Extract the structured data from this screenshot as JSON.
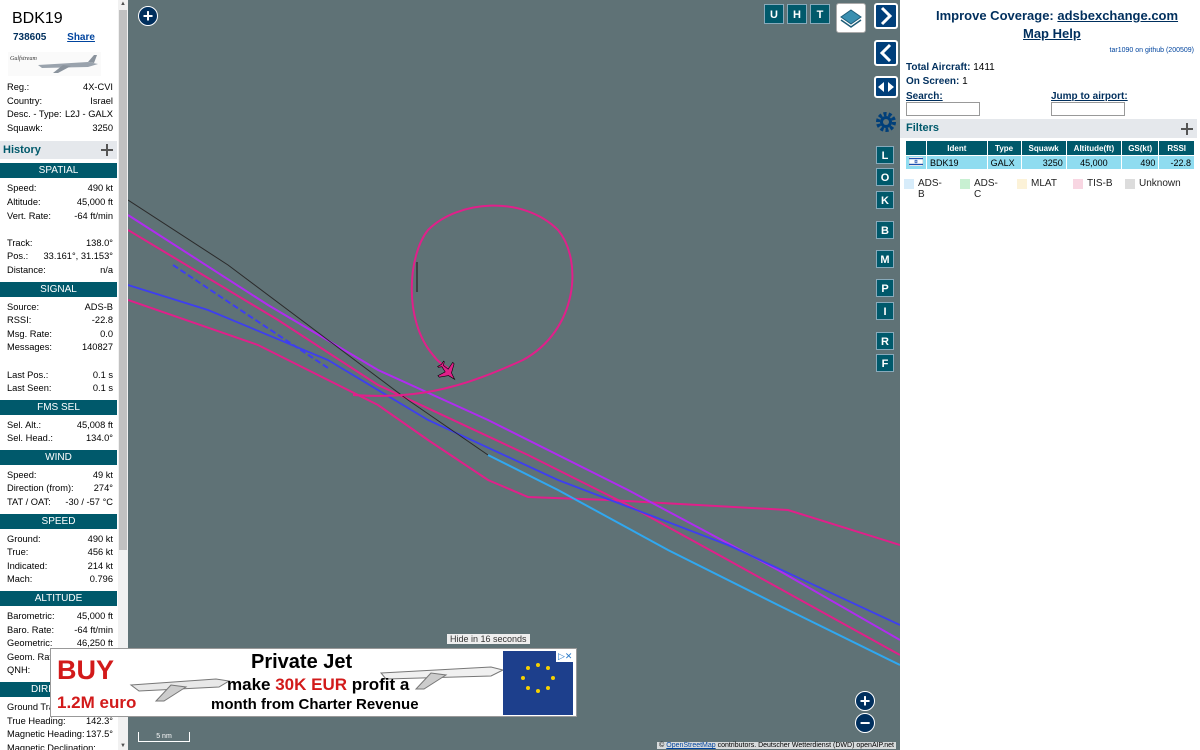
{
  "aircraft": {
    "callsign": "BDK19",
    "hex": "738605",
    "share_label": "Share",
    "photo_brand": "Gulfstream"
  },
  "details": [
    {
      "label": "Reg.:",
      "value": "4X-CVI"
    },
    {
      "label": "Country:",
      "value": "Israel"
    },
    {
      "label": "Desc. - Type:",
      "value": "L2J - GALX"
    },
    {
      "label": "Squawk:",
      "value": "3250"
    }
  ],
  "history_label": "History",
  "sections": [
    {
      "title": "SPATIAL",
      "rows": [
        {
          "label": "Speed:",
          "value": "490 kt"
        },
        {
          "label": "Altitude:",
          "value": "45,000 ft"
        },
        {
          "label": "Vert. Rate:",
          "value": "-64 ft/min"
        },
        {
          "label": "",
          "value": ""
        },
        {
          "label": "Track:",
          "value": "138.0°"
        },
        {
          "label": "Pos.:",
          "value": "33.161°, 31.153°"
        },
        {
          "label": "Distance:",
          "value": "n/a"
        }
      ]
    },
    {
      "title": "SIGNAL",
      "rows": [
        {
          "label": "Source:",
          "value": "ADS-B"
        },
        {
          "label": "RSSI:",
          "value": "-22.8"
        },
        {
          "label": "Msg. Rate:",
          "value": "0.0"
        },
        {
          "label": "Messages:",
          "value": "140827"
        },
        {
          "label": "",
          "value": ""
        },
        {
          "label": "Last Pos.:",
          "value": "0.1 s"
        },
        {
          "label": "Last Seen:",
          "value": "0.1 s"
        }
      ]
    },
    {
      "title": "FMS SEL",
      "rows": [
        {
          "label": "Sel. Alt.:",
          "value": "45,008 ft"
        },
        {
          "label": "Sel. Head.:",
          "value": "134.0°"
        }
      ]
    },
    {
      "title": "WIND",
      "rows": [
        {
          "label": "Speed:",
          "value": "49 kt"
        },
        {
          "label": "Direction (from):",
          "value": "274°"
        },
        {
          "label": "TAT / OAT:",
          "value": "-30 / -57 °C"
        }
      ]
    },
    {
      "title": "SPEED",
      "rows": [
        {
          "label": "Ground:",
          "value": "490 kt"
        },
        {
          "label": "True:",
          "value": "456 kt"
        },
        {
          "label": "Indicated:",
          "value": "214 kt"
        },
        {
          "label": "Mach:",
          "value": "0.796"
        }
      ]
    },
    {
      "title": "ALTITUDE",
      "rows": [
        {
          "label": "Barometric:",
          "value": "45,000 ft"
        },
        {
          "label": "Baro. Rate:",
          "value": "-64 ft/min"
        },
        {
          "label": "Geometric:",
          "value": "46,250 ft"
        },
        {
          "label": "Geom. Rate:",
          "value": ""
        },
        {
          "label": "QNH:",
          "value": ""
        }
      ]
    },
    {
      "title": "DIRECTION",
      "rows": [
        {
          "label": "Ground Track:",
          "value": ""
        },
        {
          "label": "True Heading:",
          "value": "142.3°"
        },
        {
          "label": "Magnetic Heading:",
          "value": "137.5°"
        },
        {
          "label": "Magnetic Declination:",
          "value": ""
        }
      ]
    }
  ],
  "map": {
    "top_buttons": [
      "U",
      "H",
      "T"
    ],
    "side_buttons": [
      "L",
      "O",
      "K",
      "B",
      "M",
      "P",
      "I",
      "R",
      "F"
    ],
    "scale_label": "5 nm",
    "attribution_prefix": "©",
    "attribution_link": "OpenStreetMap",
    "attribution_rest": "contributors. Deutscher Wetterdienst (DWD) openAIP.net",
    "track_colors": {
      "magenta": "#e0208a",
      "violet": "#a020f0",
      "blue": "#3e3ef0",
      "cyan": "#30a8f0",
      "dark": "#2a2a2a"
    }
  },
  "ad": {
    "hide_text": "Hide in 16 seconds",
    "buy": "BUY",
    "price": "1.2M euro",
    "title": "Private Jet",
    "line2_pre": "make",
    "line2_red": "30K EUR",
    "line2_post": "profit a",
    "line3": "month from Charter Revenue",
    "close_label": "▷✕"
  },
  "right": {
    "improve_prefix": "Improve Coverage:",
    "improve_link": "adsbexchange.com",
    "map_help": "Map Help",
    "version": "tar1090 on github (200509)",
    "total_label": "Total Aircraft:",
    "total_value": "1411",
    "onscreen_label": "On Screen:",
    "onscreen_value": "1",
    "search_label": "Search:",
    "jump_label": "Jump to airport:",
    "filters_label": "Filters",
    "table": {
      "headers": [
        "",
        "Ident",
        "Type",
        "Squawk",
        "Altitude(ft)",
        "GS(kt)",
        "RSSI"
      ],
      "rows": [
        [
          "",
          "BDK19",
          "GALX",
          "3250",
          "45,000",
          "490",
          "-22.8"
        ]
      ]
    },
    "legend": [
      {
        "label": "ADS-B",
        "color": "#d7ecfa"
      },
      {
        "label": "ADS-C",
        "color": "#c8f0d2"
      },
      {
        "label": "MLAT",
        "color": "#fcf2d8"
      },
      {
        "label": "TIS-B",
        "color": "#f8d6e2"
      },
      {
        "label": "Unknown",
        "color": "#dcdcdc"
      }
    ]
  }
}
